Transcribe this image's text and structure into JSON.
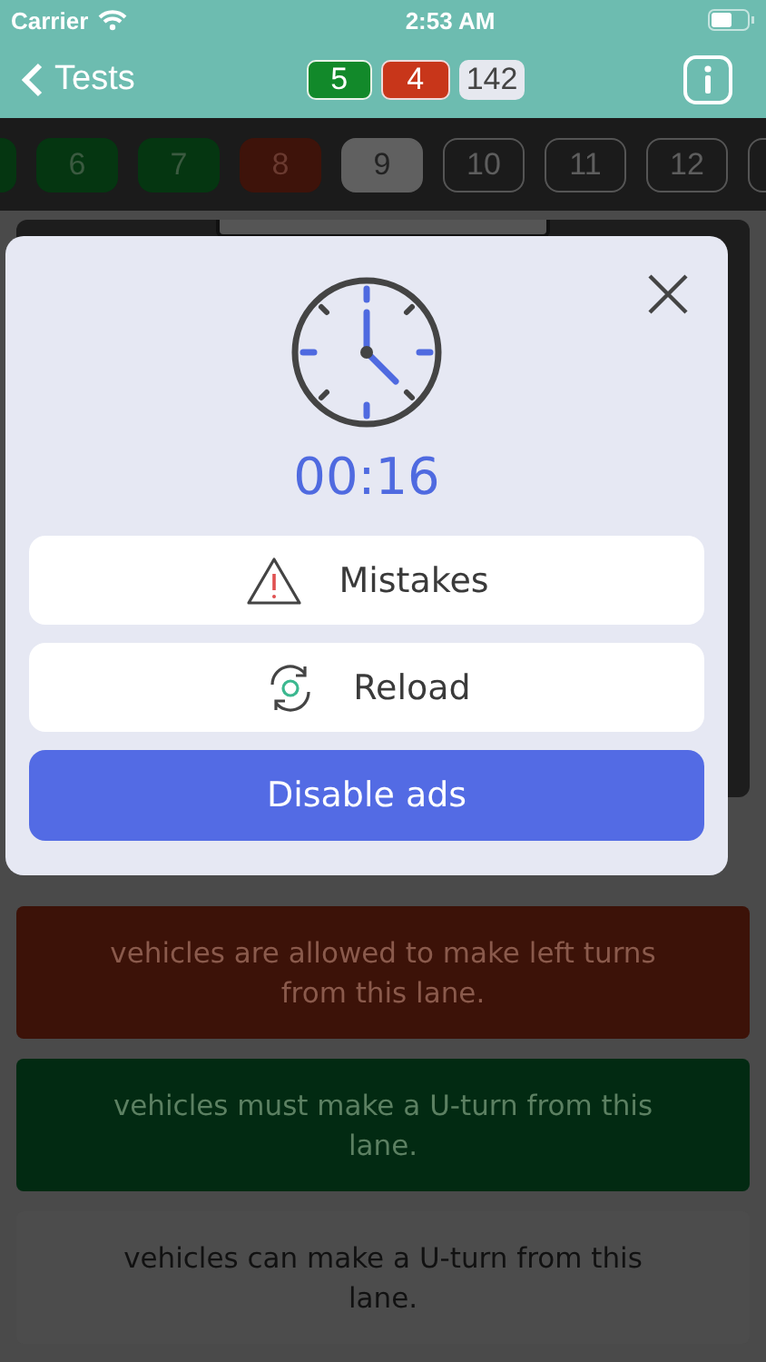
{
  "status_bar": {
    "carrier": "Carrier",
    "time": "2:53 AM"
  },
  "nav": {
    "back": "Tests",
    "scores": [
      {
        "kind": "correct",
        "value": "5"
      },
      {
        "kind": "wrong",
        "value": "4"
      },
      {
        "kind": "total",
        "value": "142"
      }
    ]
  },
  "questions": [
    {
      "kind": "correct",
      "selected": false
    },
    {
      "label": "6",
      "kind": "correct",
      "selected": false
    },
    {
      "label": "7",
      "kind": "correct",
      "selected": false
    },
    {
      "label": "8",
      "kind": "wrong",
      "selected": false
    },
    {
      "label": "9",
      "kind": "unanswered",
      "selected": true
    },
    {
      "label": "10",
      "kind": "unanswered",
      "selected": false
    },
    {
      "label": "11",
      "kind": "unanswered",
      "selected": false
    },
    {
      "label": "12",
      "kind": "unanswered",
      "selected": false
    },
    {
      "kind": "unanswered",
      "selected": false
    }
  ],
  "modal": {
    "timer": "00:16",
    "actions": [
      {
        "kind": "mistakes",
        "label": "Mistakes"
      },
      {
        "kind": "reload",
        "label": "Reload"
      },
      {
        "kind": "primary",
        "label": "Disable ads"
      }
    ]
  },
  "answers": [
    {
      "text": "vehicles are allowed to make left turns from this lane.",
      "kind": "wrong"
    },
    {
      "text": "vehicles must make a U-turn from this lane.",
      "kind": "correct"
    },
    {
      "text": "vehicles can make a U-turn from this lane.",
      "kind": "neutral"
    }
  ]
}
